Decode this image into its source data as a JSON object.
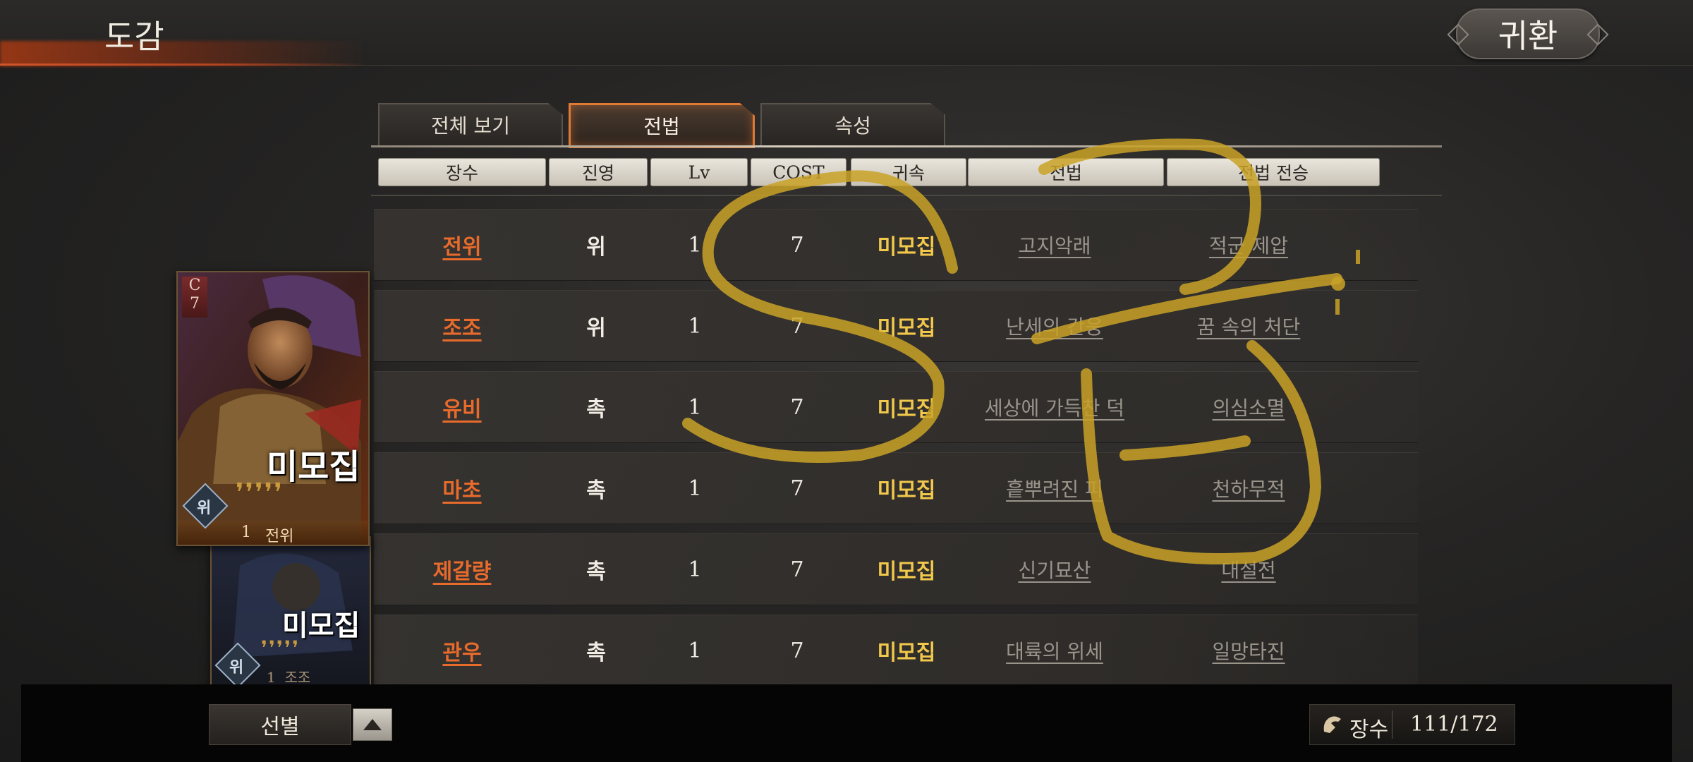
{
  "header": {
    "title": "도감",
    "return_label": "귀환"
  },
  "tabs": [
    {
      "label": "전체 보기",
      "active": false
    },
    {
      "label": "전법",
      "active": true
    },
    {
      "label": "속성",
      "active": false
    }
  ],
  "columns": [
    "장수",
    "진영",
    "Lv",
    "COST",
    "귀속",
    "전법",
    "전법 전승"
  ],
  "rows": [
    {
      "name": "전위",
      "camp": "위",
      "lv": "1",
      "cost": "7",
      "status": "미모집",
      "skill": "고지악래",
      "inherit": "적군 제압"
    },
    {
      "name": "조조",
      "camp": "위",
      "lv": "1",
      "cost": "7",
      "status": "미모집",
      "skill": "난세의 간웅",
      "inherit": "꿈 속의 처단"
    },
    {
      "name": "유비",
      "camp": "촉",
      "lv": "1",
      "cost": "7",
      "status": "미모집",
      "skill": "세상에 가득찬 덕",
      "inherit": "의심소멸"
    },
    {
      "name": "마초",
      "camp": "촉",
      "lv": "1",
      "cost": "7",
      "status": "미모집",
      "skill": "흩뿌려진 피",
      "inherit": "천하무적"
    },
    {
      "name": "제갈량",
      "camp": "촉",
      "lv": "1",
      "cost": "7",
      "status": "미모집",
      "skill": "신기묘산",
      "inherit": "대설전"
    },
    {
      "name": "관우",
      "camp": "촉",
      "lv": "1",
      "cost": "7",
      "status": "미모집",
      "skill": "대륙의 위세",
      "inherit": "일망타진"
    }
  ],
  "cards": [
    {
      "rank": "C",
      "cost": "7",
      "status": "미모집",
      "camp": "위",
      "lv": "1",
      "name": "전위",
      "drops": "❜❜❜❜❜"
    },
    {
      "status": "미모집",
      "camp": "위",
      "lv": "1",
      "name": "조조",
      "drops": "❜❜❜❜❜"
    }
  ],
  "footer": {
    "filter_label": "선별",
    "count_label": "장수",
    "count_value": "111/172"
  },
  "colors": {
    "accent_orange": "#e86b2c",
    "status_yellow": "#f1c84b",
    "annotation_yellow": "#c9a227"
  },
  "icons": [
    "chevron-up-icon",
    "general-helmet-icon",
    "camp-diamond-icon"
  ]
}
